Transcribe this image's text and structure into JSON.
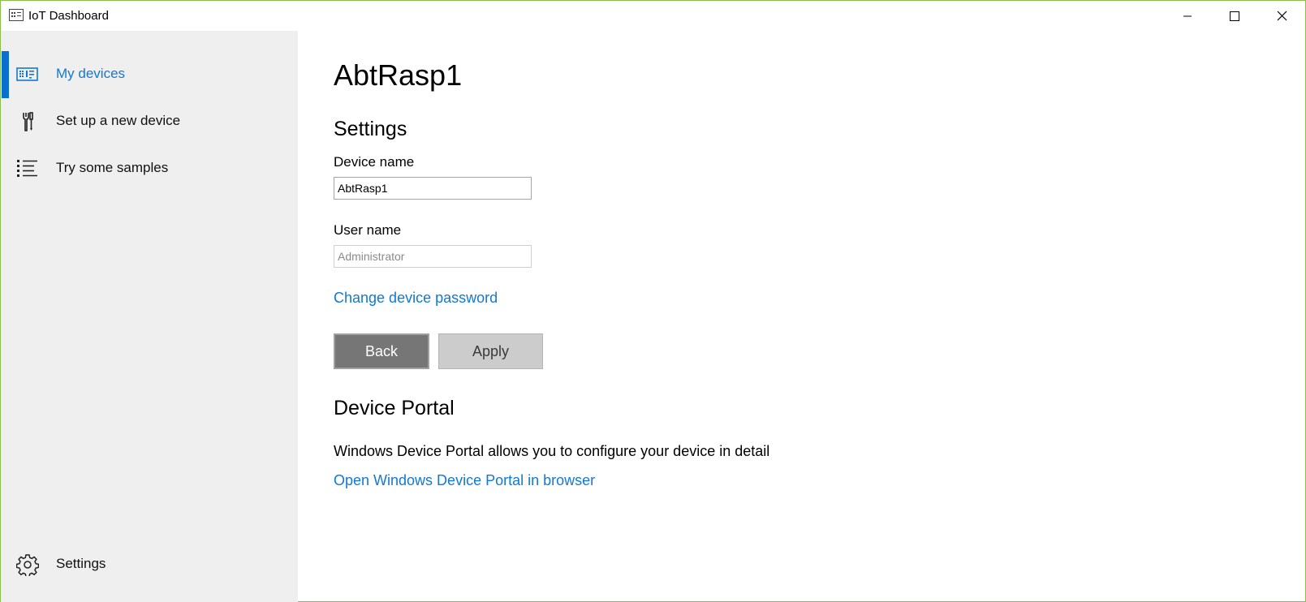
{
  "window": {
    "title": "IoT Dashboard",
    "icons": {
      "app": "dashboard-icon",
      "minimize": "minimize-icon",
      "maximize": "maximize-icon",
      "close": "close-icon"
    }
  },
  "sidebar": {
    "items": [
      {
        "label": "My devices",
        "icon": "devices-icon",
        "active": true
      },
      {
        "label": "Set up a new device",
        "icon": "tools-icon",
        "active": false
      },
      {
        "label": "Try some samples",
        "icon": "list-icon",
        "active": false
      }
    ],
    "settings": {
      "label": "Settings",
      "icon": "gear-icon"
    }
  },
  "main": {
    "title": "AbtRasp1",
    "settings_heading": "Settings",
    "device_name": {
      "label": "Device name",
      "value": "AbtRasp1"
    },
    "user_name": {
      "label": "User name",
      "placeholder": "Administrator"
    },
    "change_password_link": "Change device password",
    "buttons": {
      "back": "Back",
      "apply": "Apply"
    },
    "portal": {
      "heading": "Device Portal",
      "description": "Windows Device Portal allows you to configure your device in detail",
      "link": "Open Windows Device Portal in browser"
    }
  },
  "colors": {
    "accent": "#1378d4",
    "sidebar_bg": "#efefef",
    "back_button": "#767676",
    "apply_button": "#cccccc",
    "window_border": "#8cbf4a"
  }
}
